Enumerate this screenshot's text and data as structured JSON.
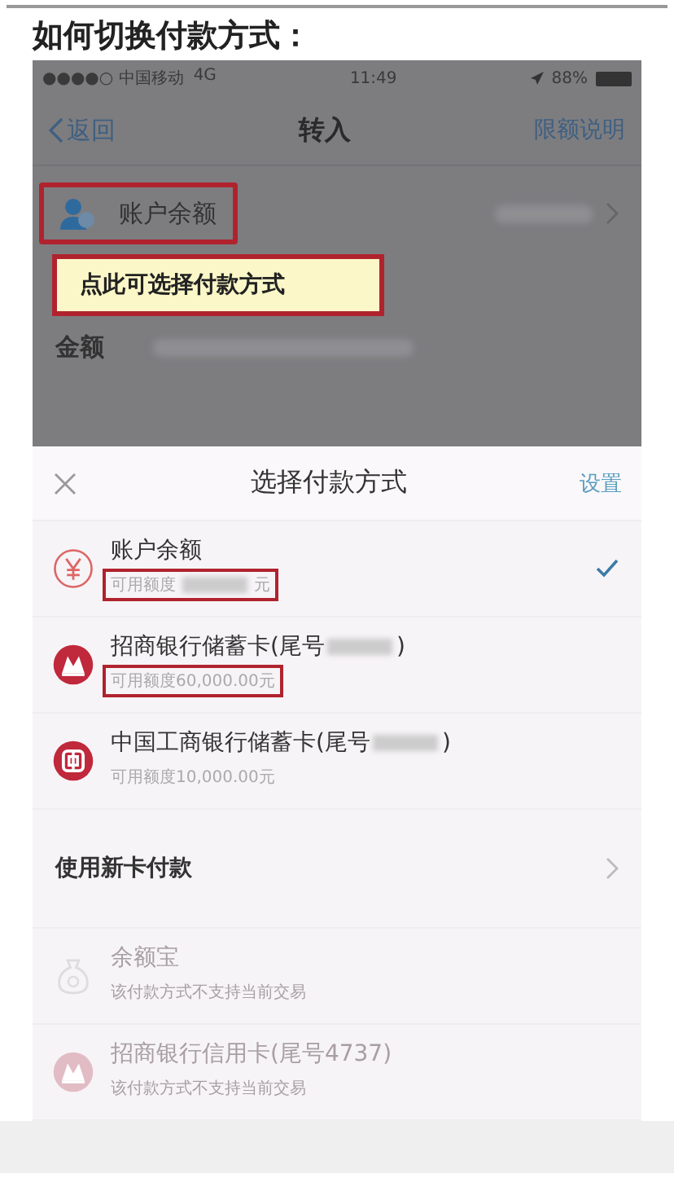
{
  "heading": "如何切换付款方式：",
  "status_bar": {
    "carrier": "●●●●○ 中国移动",
    "network": "4G",
    "time": "11:49",
    "battery": "88%"
  },
  "nav": {
    "back": "返回",
    "title": "转入",
    "action": "限额说明"
  },
  "form": {
    "account": {
      "label": "账户余额",
      "highlighted": true
    },
    "tooltip": "点此可选择付款方式",
    "amount_label": "金额"
  },
  "sheet": {
    "title": "选择付款方式",
    "action": "设置",
    "methods": [
      {
        "kind": "balance",
        "name": "账户余额",
        "sub_prefix": "可用额度",
        "sub_suffix": "元",
        "masked": true,
        "highlighted": true,
        "selected": true,
        "disabled": false
      },
      {
        "kind": "cmb",
        "name": "招商银行储蓄卡(尾号",
        "name_suffix": ")",
        "sub_prefix": "可用额度60,000.00元",
        "highlighted": true,
        "selected": false,
        "disabled": false
      },
      {
        "kind": "icbc",
        "name": "中国工商银行储蓄卡(尾号",
        "name_suffix": ")",
        "sub_prefix": "可用额度10,000.00元",
        "highlighted": false,
        "selected": false,
        "disabled": false
      }
    ],
    "new_card": "使用新卡付款",
    "unavailable": [
      {
        "kind": "yuebao",
        "name": "余额宝",
        "sub_prefix": "该付款方式不支持当前交易",
        "disabled": true
      },
      {
        "kind": "cmb",
        "name": "招商银行信用卡(尾号4737)",
        "sub_prefix": "该付款方式不支持当前交易",
        "disabled": true
      }
    ]
  }
}
